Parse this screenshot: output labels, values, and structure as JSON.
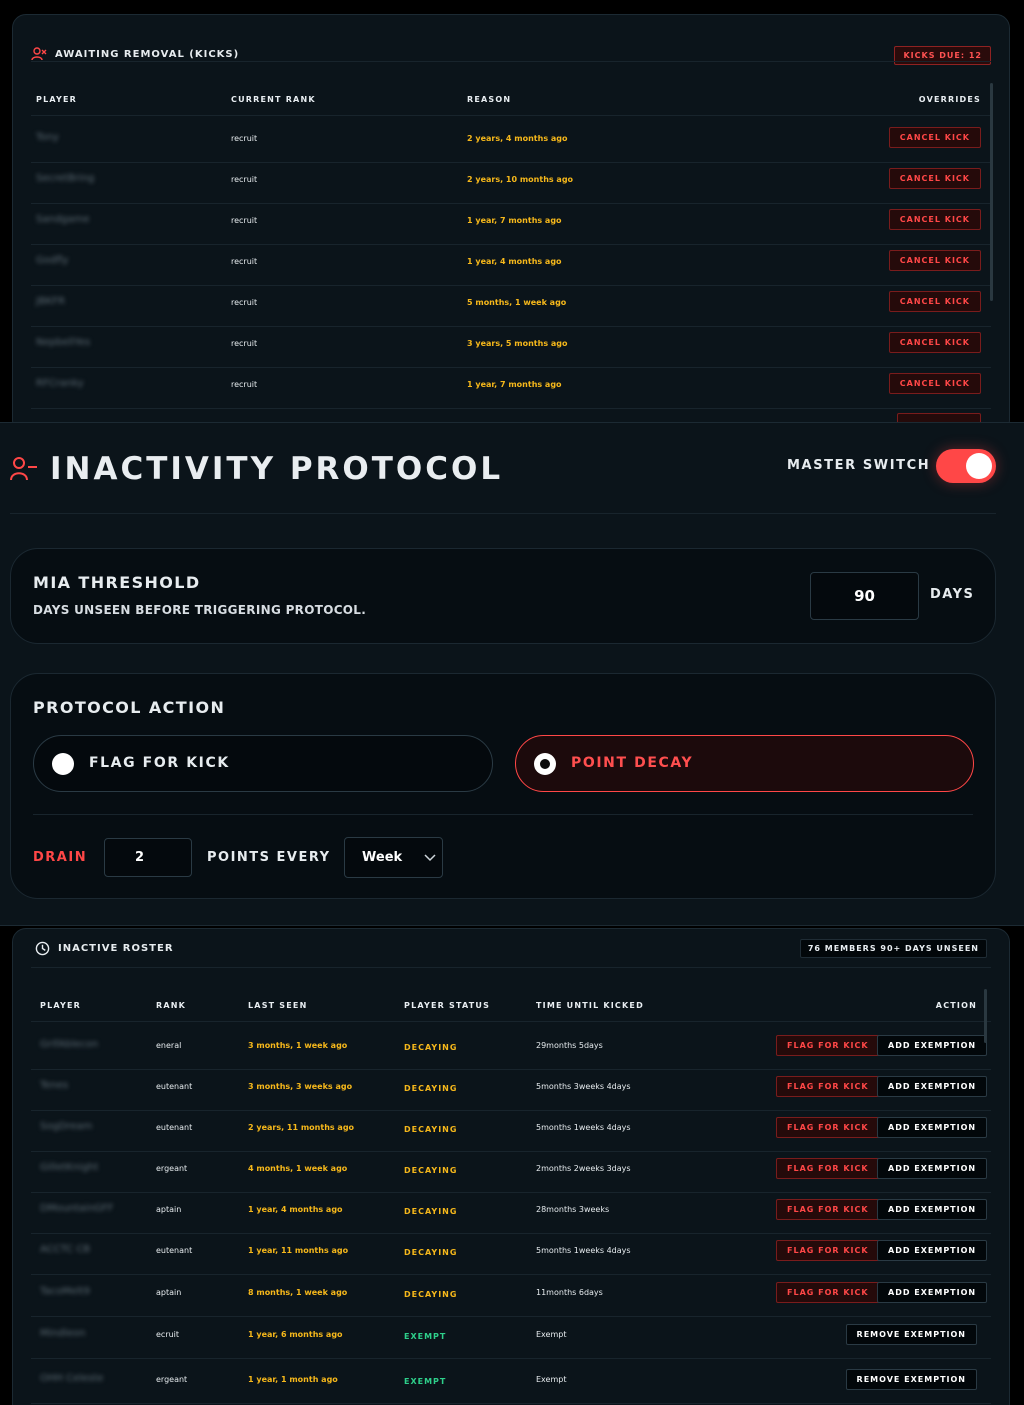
{
  "kicks": {
    "title": "AWAITING REMOVAL (KICKS)",
    "badge": "KICKS DUE: 12",
    "columns": [
      "PLAYER",
      "CURRENT RANK",
      "REASON",
      "OVERRIDES"
    ],
    "rows": [
      {
        "player": "Tony",
        "rank": "recruit",
        "reason": "2 years, 4 months ago",
        "action": "CANCEL KICK"
      },
      {
        "player": "SecretBring",
        "rank": "recruit",
        "reason": "2 years, 10 months ago",
        "action": "CANCEL KICK"
      },
      {
        "player": "Sandgame",
        "rank": "recruit",
        "reason": "1 year, 7 months ago",
        "action": "CANCEL KICK"
      },
      {
        "player": "Godfly",
        "rank": "recruit",
        "reason": "1 year, 4 months ago",
        "action": "CANCEL KICK"
      },
      {
        "player": "JBKFR",
        "rank": "recruit",
        "reason": "5 months, 1 week ago",
        "action": "CANCEL KICK"
      },
      {
        "player": "NepbellYes",
        "rank": "recruit",
        "reason": "3 years, 5 months ago",
        "action": "CANCEL KICK"
      },
      {
        "player": "RFCranky",
        "rank": "recruit",
        "reason": "1 year, 7 months ago",
        "action": "CANCEL KICK"
      }
    ]
  },
  "protocol": {
    "title": "INACTIVITY PROTOCOL",
    "master_switch_label": "MASTER SWITCH",
    "master_switch_on": true,
    "accent": "#ff4747",
    "threshold": {
      "title": "MIA THRESHOLD",
      "subtitle": "DAYS UNSEEN BEFORE TRIGGERING PROTOCOL.",
      "value": "90",
      "unit": "DAYS"
    },
    "action": {
      "title": "PROTOCOL ACTION",
      "options": [
        {
          "label": "FLAG FOR KICK",
          "selected": false
        },
        {
          "label": "POINT DECAY",
          "selected": true
        }
      ],
      "drain_label": "DRAIN",
      "drain_value": "2",
      "points_every_label": "POINTS EVERY",
      "period": "Week"
    }
  },
  "roster": {
    "title": "INACTIVE ROSTER",
    "badge": "76 MEMBERS 90+ DAYS UNSEEN",
    "columns": [
      "PLAYER",
      "RANK",
      "LAST SEEN",
      "PLAYER STATUS",
      "TIME UNTIL KICKED",
      "ACTION"
    ],
    "rows": [
      {
        "player": "GrifAblecon",
        "rank": "eneral",
        "last_seen": "3 months, 1 week ago",
        "status": "DECAYING",
        "time": "29months 5days",
        "flag": "FLAG FOR KICK",
        "exemption": "ADD EXEMPTION"
      },
      {
        "player": "Tenes",
        "rank": "eutenant",
        "last_seen": "3 months, 3 weeks ago",
        "status": "DECAYING",
        "time": "5months 3weeks 4days",
        "flag": "FLAG FOR KICK",
        "exemption": "ADD EXEMPTION"
      },
      {
        "player": "SogDream",
        "rank": "eutenant",
        "last_seen": "2 years, 11 months ago",
        "status": "DECAYING",
        "time": "5months 1weeks 4days",
        "flag": "FLAG FOR KICK",
        "exemption": "ADD EXEMPTION"
      },
      {
        "player": "GilletKnight",
        "rank": "ergeant",
        "last_seen": "4 months, 1 week ago",
        "status": "DECAYING",
        "time": "2months 2weeks 3days",
        "flag": "FLAG FOR KICK",
        "exemption": "ADD EXEMPTION"
      },
      {
        "player": "DMountainGFF",
        "rank": "aptain",
        "last_seen": "1 year, 4 months ago",
        "status": "DECAYING",
        "time": "28months 3weeks",
        "flag": "FLAG FOR KICK",
        "exemption": "ADD EXEMPTION"
      },
      {
        "player": "ACCTC CB",
        "rank": "eutenant",
        "last_seen": "1 year, 11 months ago",
        "status": "DECAYING",
        "time": "5months 1weeks 4days",
        "flag": "FLAG FOR KICK",
        "exemption": "ADD EXEMPTION"
      },
      {
        "player": "TacoMelt9",
        "rank": "aptain",
        "last_seen": "8 months, 1 week ago",
        "status": "DECAYING",
        "time": "11months 6days",
        "flag": "FLAG FOR KICK",
        "exemption": "ADD EXEMPTION"
      },
      {
        "player": "Mindleon",
        "rank": "ecruit",
        "last_seen": "1 year, 6 months ago",
        "status": "EXEMPT",
        "time": "Exempt",
        "flag": "",
        "exemption": "REMOVE EXEMPTION"
      },
      {
        "player": "OHH Celeste",
        "rank": "ergeant",
        "last_seen": "1 year, 1 month ago",
        "status": "EXEMPT",
        "time": "Exempt",
        "flag": "",
        "exemption": "REMOVE EXEMPTION"
      }
    ]
  }
}
